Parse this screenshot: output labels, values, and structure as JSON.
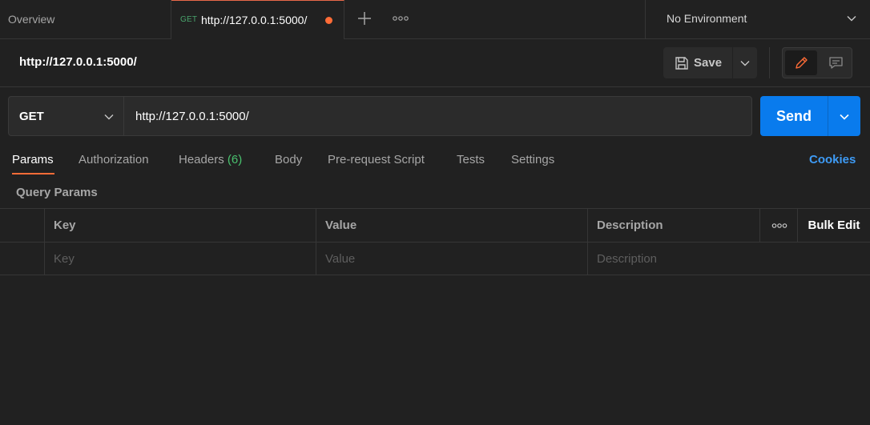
{
  "tabbar": {
    "overview_label": "Overview",
    "active_tab": {
      "method": "GET",
      "url": "http://127.0.0.1:5000/",
      "unsaved": true
    },
    "environment": "No Environment"
  },
  "header": {
    "title": "http://127.0.0.1:5000/",
    "save_label": "Save"
  },
  "request": {
    "method": "GET",
    "url": "http://127.0.0.1:5000/",
    "send_label": "Send"
  },
  "tabs": [
    {
      "label": "Params",
      "active": true
    },
    {
      "label": "Authorization"
    },
    {
      "label": "Headers",
      "count": "(6)"
    },
    {
      "label": "Body"
    },
    {
      "label": "Pre-request Script"
    },
    {
      "label": "Tests"
    },
    {
      "label": "Settings"
    }
  ],
  "cookies_label": "Cookies",
  "query_params": {
    "title": "Query Params",
    "columns": [
      "Key",
      "Value",
      "Description"
    ],
    "bulk_edit_label": "Bulk Edit",
    "placeholders": {
      "key": "Key",
      "value": "Value",
      "description": "Description"
    }
  },
  "colors": {
    "accent": "#ff6c37",
    "send": "#097bed",
    "method_get": "#49a36c",
    "link": "#3e9bf5"
  }
}
